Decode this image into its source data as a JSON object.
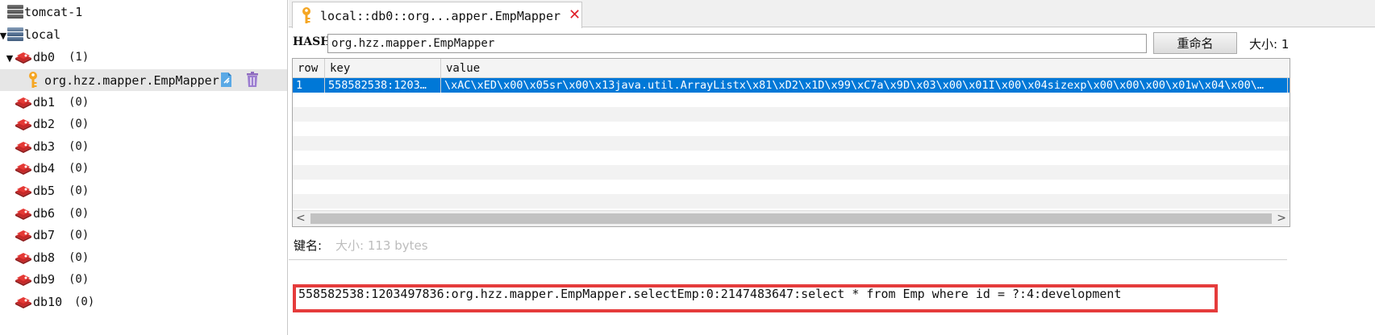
{
  "tree": {
    "servers": [
      {
        "name": "tomcat-1"
      },
      {
        "name": "local"
      }
    ],
    "databases": [
      {
        "name": "db0",
        "count": "(1)"
      },
      {
        "name": "db1",
        "count": "(0)"
      },
      {
        "name": "db2",
        "count": "(0)"
      },
      {
        "name": "db3",
        "count": "(0)"
      },
      {
        "name": "db4",
        "count": "(0)"
      },
      {
        "name": "db5",
        "count": "(0)"
      },
      {
        "name": "db6",
        "count": "(0)"
      },
      {
        "name": "db7",
        "count": "(0)"
      },
      {
        "name": "db8",
        "count": "(0)"
      },
      {
        "name": "db9",
        "count": "(0)"
      },
      {
        "name": "db10",
        "count": "(0)"
      }
    ],
    "selected_key": "org.hzz.mapper.EmpMapper"
  },
  "tab": {
    "title": "local::db0::org...apper.EmpMapper",
    "close": "✕"
  },
  "hash": {
    "label": "HASH:",
    "value": "org.hzz.mapper.EmpMapper",
    "rename_label": "重命名",
    "size_text": "大小: 1"
  },
  "table": {
    "columns": [
      "row",
      "key",
      "value"
    ],
    "rows": [
      {
        "row": "1",
        "key": "558582538:1203…",
        "value": "\\xAC\\xED\\x00\\x05sr\\x00\\x13java.util.ArrayListx\\x81\\xD2\\x1D\\x99\\xC7a\\x9D\\x03\\x00\\x01I\\x00\\x04sizexp\\x00\\x00\\x00\\x01w\\x04\\x00\\…"
      }
    ],
    "scroll_left": "<",
    "scroll_right": ">"
  },
  "detail": {
    "key_label": "键名:",
    "size_label": "大小: 113 bytes",
    "value": "558582538:1203497836:org.hzz.mapper.EmpMapper.selectEmp:0:2147483647:select * from Emp where id = ?:4:development"
  }
}
